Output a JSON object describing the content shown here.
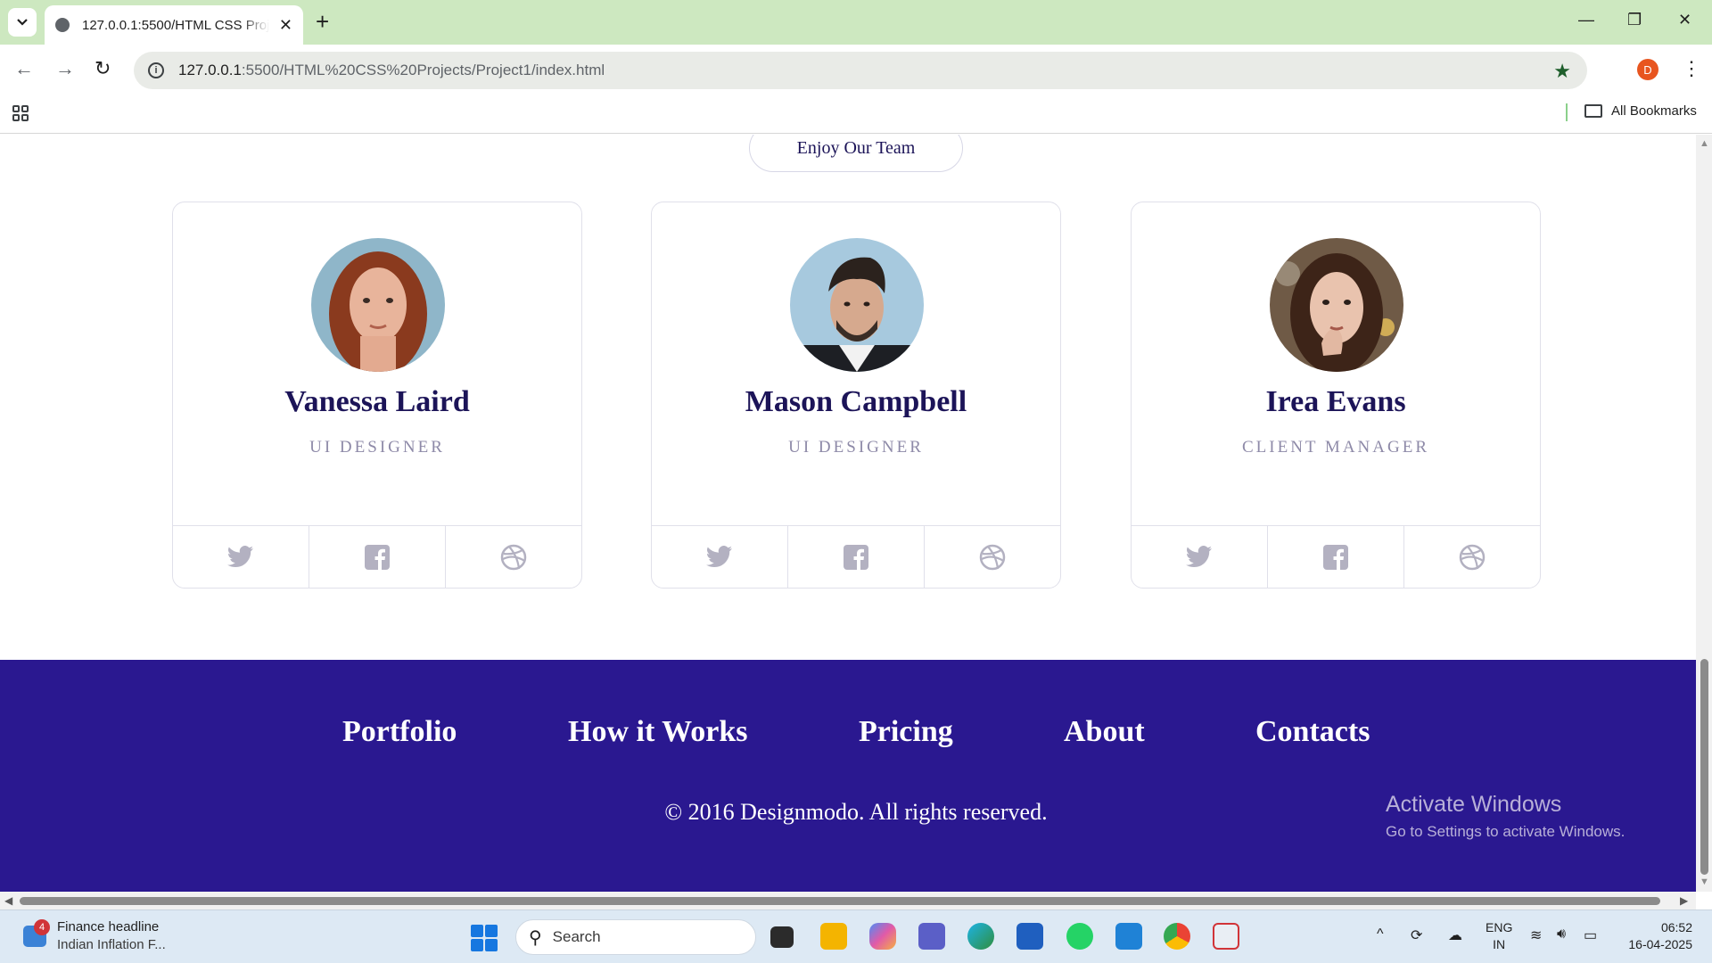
{
  "browser": {
    "tab_title": "127.0.0.1:5500/HTML CSS Projects/Project1/index.html",
    "tab_close": "✕",
    "new_tab": "+",
    "url_host": "127.0.0.1",
    "url_rest": ":5500/HTML%20CSS%20Projects/Project1/index.html",
    "profile_initial": "D",
    "all_bookmarks": "All Bookmarks"
  },
  "page": {
    "section_pill": "Enjoy Our Team",
    "team": [
      {
        "name": "Vanessa Laird",
        "role": "UI DESIGNER",
        "avatar": "woman-red-hair-portrait"
      },
      {
        "name": "Mason Campbell",
        "role": "UI DESIGNER",
        "avatar": "man-dark-hair-portrait"
      },
      {
        "name": "Irea Evans",
        "role": "CLIENT MANAGER",
        "avatar": "woman-brown-hair-portrait"
      }
    ],
    "social_icons": [
      "twitter-icon",
      "facebook-icon",
      "dribbble-icon"
    ],
    "footer": {
      "links": [
        "Portfolio",
        "How it Works",
        "Pricing",
        "About",
        "Contacts"
      ],
      "copyright": "© 2016 Designmodo. All rights reserved."
    },
    "watermark": {
      "title": "Activate Windows",
      "subtitle": "Go to Settings to activate Windows."
    }
  },
  "taskbar": {
    "widget_badge": "4",
    "news_title": "Finance headline",
    "news_subtitle": "Indian Inflation F...",
    "search_label": "Search",
    "lang_line1": "ENG",
    "lang_line2": "IN",
    "time": "06:52",
    "date": "16-04-2025"
  },
  "colors": {
    "brand_navy": "#1c1458",
    "footer_bg": "#2a1890",
    "tabstrip_bg": "#cde8c0"
  }
}
